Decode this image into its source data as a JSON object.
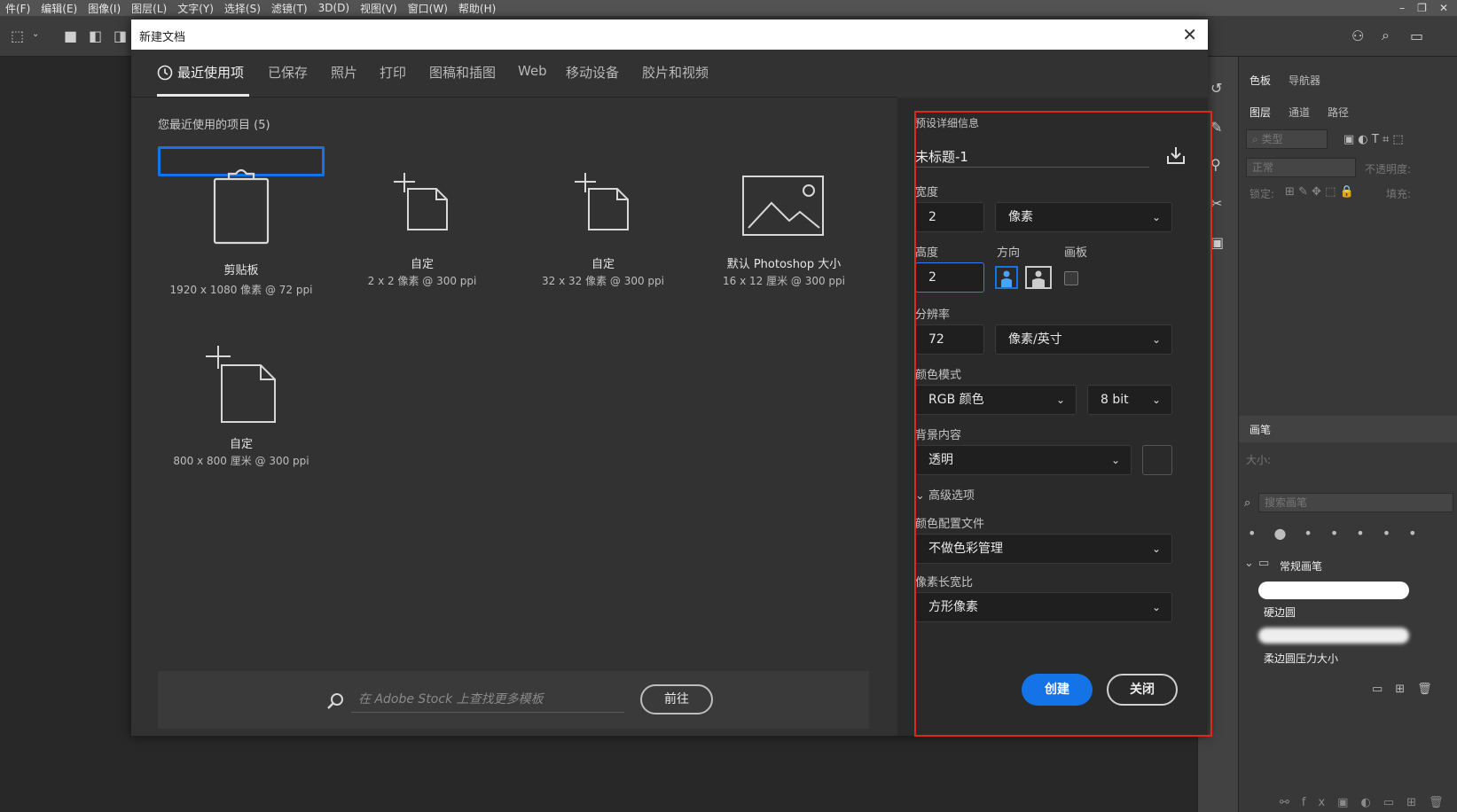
{
  "menubar": [
    "件(F)",
    "编辑(E)",
    "图像(I)",
    "图层(L)",
    "文字(Y)",
    "选择(S)",
    "滤镜(T)",
    "3D(D)",
    "视图(V)",
    "窗口(W)",
    "帮助(H)"
  ],
  "window_controls": {
    "minimize": "–",
    "restore": "❐",
    "close": "✕"
  },
  "dialog": {
    "title": "新建文档",
    "close_glyph": "✕",
    "tabs": [
      "最近使用项",
      "已保存",
      "照片",
      "打印",
      "图稿和插图",
      "Web",
      "移动设备",
      "胶片和视频"
    ],
    "recent_heading": "您最近使用的项目 (5)",
    "cards": [
      {
        "name": "剪贴板",
        "desc": "1920 x 1080 像素 @ 72 ppi"
      },
      {
        "name": "自定",
        "desc": "2 x 2 像素 @ 300 ppi"
      },
      {
        "name": "自定",
        "desc": "32 x 32 像素 @ 300 ppi"
      },
      {
        "name": "默认 Photoshop 大小",
        "desc": "16 x 12 厘米 @ 300 ppi"
      },
      {
        "name": "自定",
        "desc": "800 x 800 厘米 @ 300 ppi"
      }
    ],
    "stock": {
      "placeholder": "在 Adobe Stock 上查找更多模板",
      "go": "前往"
    },
    "details": {
      "header": "预设详细信息",
      "doc_name": "未标题-1",
      "width_label": "宽度",
      "width_value": "2",
      "width_unit": "像素",
      "height_label": "高度",
      "height_value": "2",
      "orientation_label": "方向",
      "artboard_label": "画板",
      "resolution_label": "分辨率",
      "resolution_value": "72",
      "resolution_unit": "像素/英寸",
      "color_mode_label": "颜色模式",
      "color_mode": "RGB 颜色",
      "bit_depth": "8 bit",
      "background_label": "背景内容",
      "background": "透明",
      "advanced_label": "高级选项",
      "color_profile_label": "颜色配置文件",
      "color_profile": "不做色彩管理",
      "pixel_aspect_label": "像素长宽比",
      "pixel_aspect": "方形像素",
      "create": "创建",
      "close": "关闭"
    }
  },
  "right_panels": {
    "top_tabs": [
      "色板",
      "导航器"
    ],
    "layer_tabs": [
      "图层",
      "通道",
      "路径"
    ],
    "layer_filter": "类型",
    "blend_mode": "正常",
    "opacity_label": "不透明度:",
    "lock_label": "锁定:",
    "fill_label": "填充:",
    "brush_tab": "画笔",
    "size_label": "大小:",
    "brush_search": "搜索画笔",
    "brush_group": "常规画笔",
    "brushes": [
      "硬边圆",
      "柔边圆压力大小"
    ]
  },
  "colors": {
    "accent": "#1473e6",
    "highlight": "#e0261d"
  }
}
